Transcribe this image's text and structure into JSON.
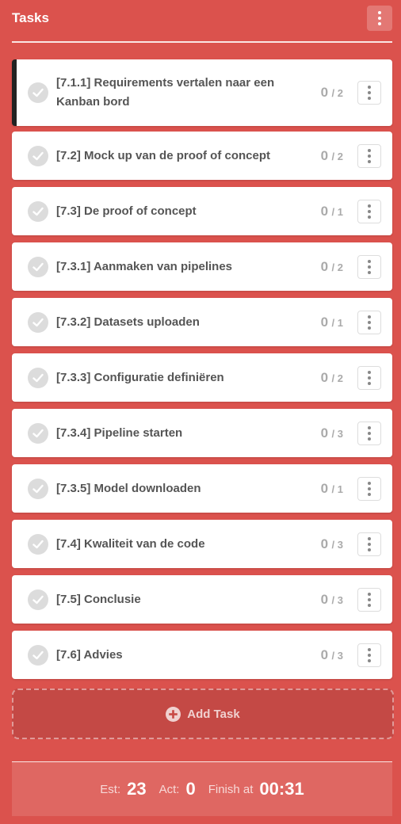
{
  "header": {
    "title": "Tasks",
    "menu_icon": "kebab-menu-icon"
  },
  "tasks": [
    {
      "name": "[7.1.1] Requirements vertalen naar een Kanban bord",
      "act": "0",
      "est": "/ 2",
      "active": true
    },
    {
      "name": "[7.2] Mock up van de proof of concept",
      "act": "0",
      "est": "/ 2"
    },
    {
      "name": "[7.3] De proof of concept",
      "act": "0",
      "est": "/ 1"
    },
    {
      "name": "[7.3.1] Aanmaken van pipelines",
      "act": "0",
      "est": "/ 2"
    },
    {
      "name": "[7.3.2] Datasets uploaden",
      "act": "0",
      "est": "/ 1"
    },
    {
      "name": "[7.3.3] Configuratie definiëren",
      "act": "0",
      "est": "/ 2"
    },
    {
      "name": "[7.3.4] Pipeline starten",
      "act": "0",
      "est": "/ 3"
    },
    {
      "name": "[7.3.5] Model downloaden",
      "act": "0",
      "est": "/ 1"
    },
    {
      "name": "[7.4] Kwaliteit van de code",
      "act": "0",
      "est": "/ 3"
    },
    {
      "name": "[7.5] Conclusie",
      "act": "0",
      "est": "/ 3"
    },
    {
      "name": "[7.6] Advies",
      "act": "0",
      "est": "/ 3"
    }
  ],
  "add_task": {
    "label": "Add Task",
    "icon": "plus-circle-icon"
  },
  "footer": {
    "est_label": "Est:",
    "est_value": "23",
    "act_label": "Act:",
    "act_value": "0",
    "finish_label": "Finish at",
    "finish_value": "00:31"
  },
  "colors": {
    "background": "#db524d",
    "card": "#ffffff",
    "active_border": "#222222",
    "check": "#dcdcdc"
  }
}
